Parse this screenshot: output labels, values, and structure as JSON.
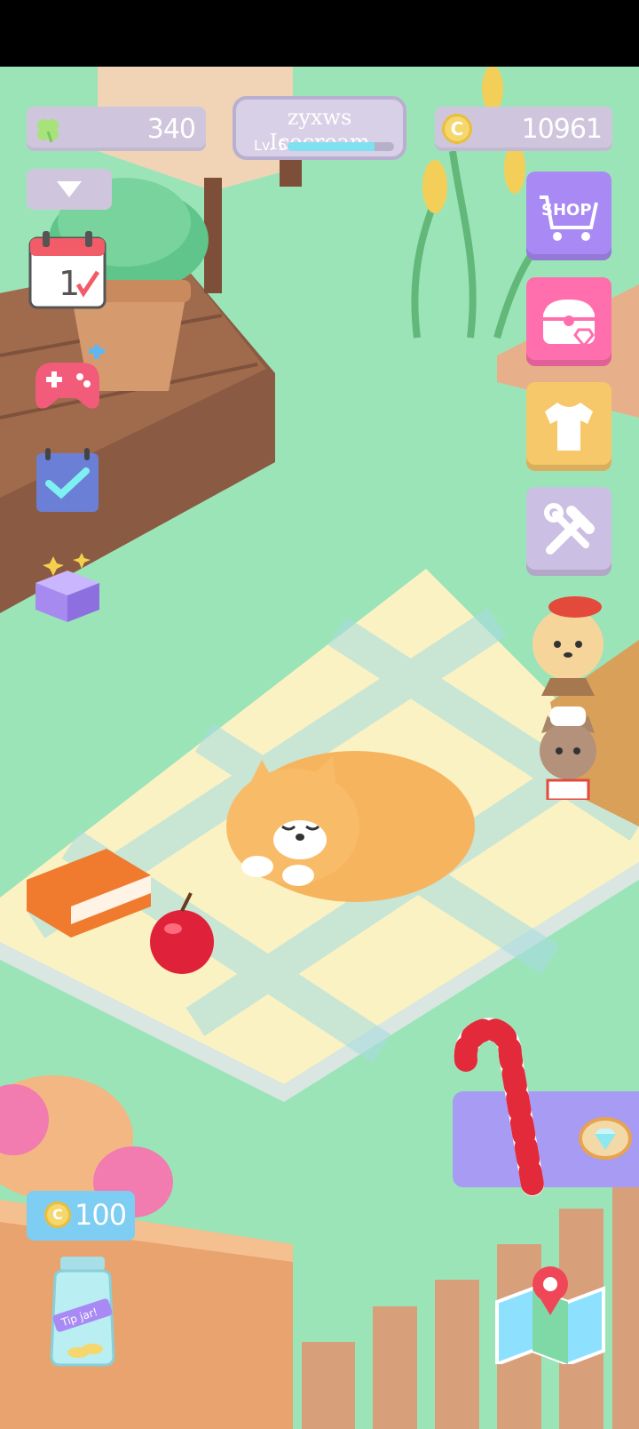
{
  "hud": {
    "clover_count": "340",
    "coin_count": "10961",
    "coin_symbol": "C",
    "player_name": "zyxws Icecream",
    "level_label": "Lv. 5",
    "xp_fraction": 0.82
  },
  "right_menu": {
    "shop_label": "SHOP"
  },
  "calendar": {
    "day": "1"
  },
  "tip_jar": {
    "amount": "100",
    "jar_text": "Tip jar!"
  },
  "colors": {
    "grass": "#9be4b8",
    "shop_button": "#a98af5",
    "chest_button": "#ff6fae",
    "outfit_button": "#f7c86a",
    "tools_button": "#cbbfe3",
    "hud_pill": "#cfc6de",
    "promo_banner": "#a89bf4"
  },
  "icons": [
    "clover-icon",
    "coin-icon",
    "dropdown-icon",
    "calendar-icon",
    "gamepad-icon",
    "checklist-icon",
    "gift-box-icon",
    "shop-cart-icon",
    "chest-icon",
    "tshirt-icon",
    "tools-icon",
    "map-icon",
    "tip-jar-icon"
  ]
}
